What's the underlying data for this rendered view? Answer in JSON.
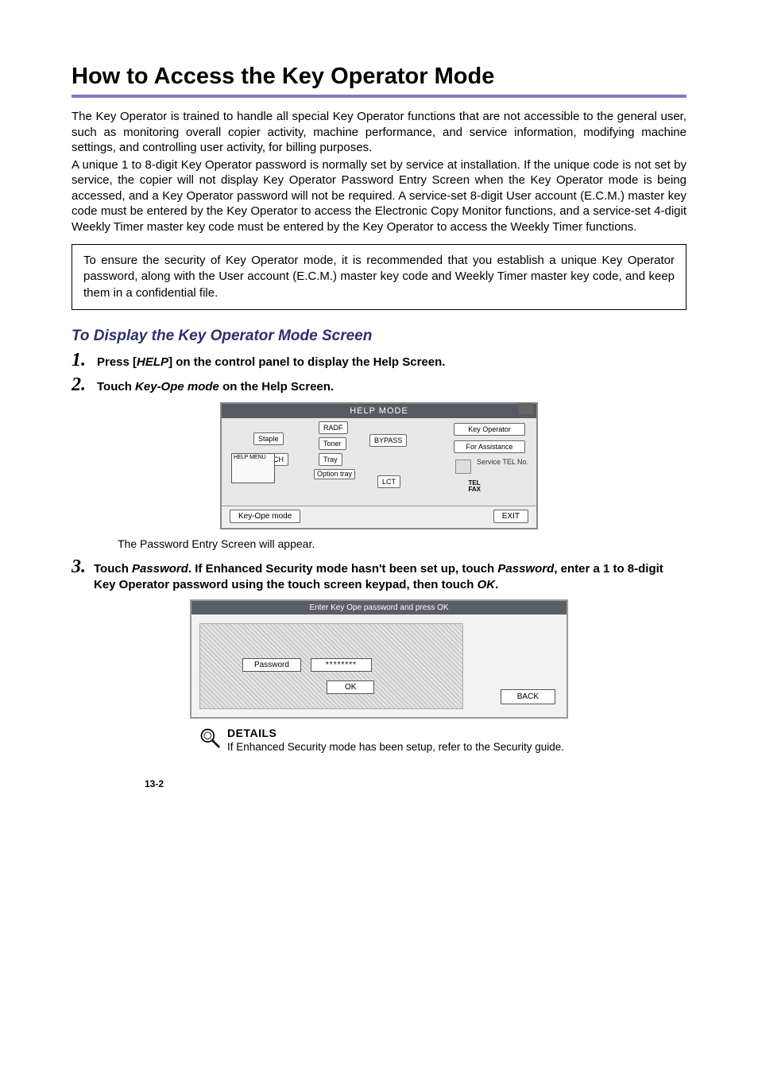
{
  "title": "How to Access the Key Operator Mode",
  "para1": "The Key Operator is trained to handle all special Key Operator functions that are not accessible to the general user, such as monitoring overall copier activity, machine performance, and service information, modifying machine settings, and controlling user activity, for billing purposes.",
  "para2": "A unique 1 to 8-digit Key Operator password is normally set by service at installation. If the unique code is not set by service, the copier will not display Key Operator Password Entry Screen when the Key Operator mode is being accessed, and a Key Operator password will not be required. A service-set 8-digit User account (E.C.M.) master key code must be entered by the Key Operator to access the Electronic Copy Monitor functions, and a service-set 4-digit Weekly Timer master key code must be entered by the Key Operator to access the Weekly Timer functions.",
  "callout": "To ensure the security of Key Operator mode, it is recommended that you establish a unique Key Operator password, along with the User account (E.C.M.) master key code and Weekly Timer master key code, and keep them in a confidential file.",
  "subhead": "To Display the Key Operator Mode Screen",
  "steps": {
    "s1": {
      "num": "1.",
      "pre": "Press [",
      "bold_ital": "HELP",
      "post": "] on the control panel to display the Help Screen."
    },
    "s2": {
      "num": "2.",
      "pre": "Touch ",
      "bold_ital": "Key-Ope mode",
      "post": " on the Help Screen."
    },
    "s3": {
      "num": "3.",
      "pre": "Touch ",
      "bi1": "Password",
      "mid1": ". If Enhanced Security mode hasn't been set up, touch ",
      "bi2": "Password",
      "mid2": ", enter a 1 to 8-digit Key Operator password using the touch screen keypad, then touch ",
      "bi3": "OK",
      "post": "."
    }
  },
  "substep_after_fig1": "The Password Entry Screen will appear.",
  "fig1": {
    "titlebar": "HELP MODE",
    "staple": "Staple",
    "punch": "PUNCH",
    "help_menu": "HELP MENU",
    "radf": "RADF",
    "toner": "Toner",
    "tray": "Tray",
    "option_tray": "Option tray",
    "bypass": "BYPASS",
    "lct": "LCT",
    "key_operator": "Key Operator",
    "for_assistance": "For Assistance",
    "service_tel": "Service TEL No.",
    "tel": "TEL",
    "fax": "FAX",
    "keyope": "Key-Ope mode",
    "exit": "EXIT"
  },
  "fig2": {
    "titlebar": "Enter Key Ope password\nand press OK",
    "password_label": "Password",
    "password_value": "********",
    "ok": "OK",
    "back": "BACK"
  },
  "details": {
    "head": "DETAILS",
    "text": "If Enhanced Security mode has been setup, refer to the Security guide."
  },
  "page_num": "13-2"
}
